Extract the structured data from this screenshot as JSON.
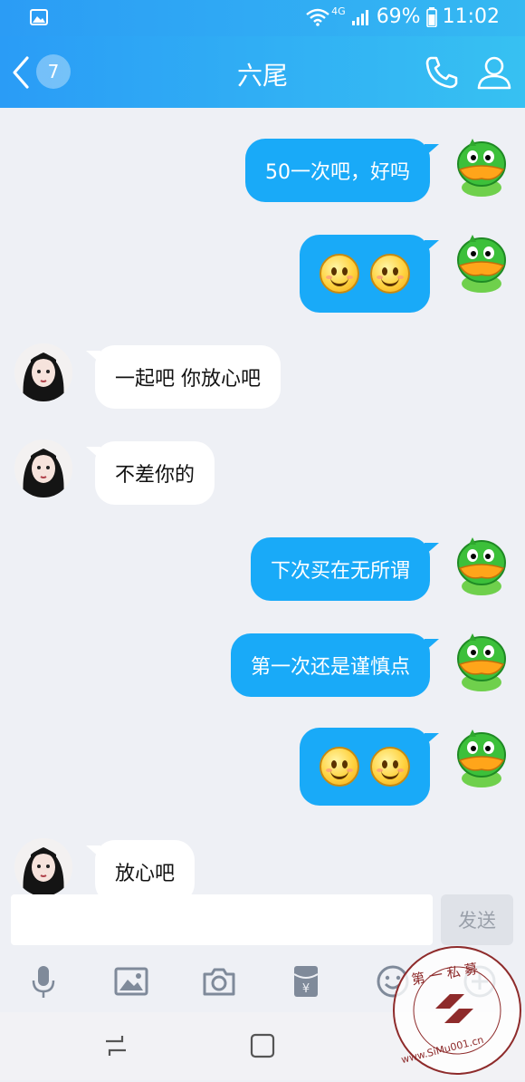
{
  "status_bar": {
    "network": "4G",
    "battery": "69%",
    "time": "11:02"
  },
  "header": {
    "back_badge": "7",
    "title": "六尾"
  },
  "messages": [
    {
      "side": "out",
      "text": "50一次吧，好吗"
    },
    {
      "side": "out",
      "emoji": [
        "smile",
        "smile"
      ]
    },
    {
      "side": "in",
      "text": "一起吧 你放心吧"
    },
    {
      "side": "in",
      "text": "不差你的"
    },
    {
      "side": "out",
      "text": "下次买在无所谓"
    },
    {
      "side": "out",
      "text": "第一次还是谨慎点"
    },
    {
      "side": "out",
      "emoji": [
        "smile",
        "smile"
      ]
    },
    {
      "side": "in",
      "text": "放心吧"
    }
  ],
  "composer": {
    "input_value": "",
    "input_placeholder": "",
    "send_label": "发送"
  },
  "toolbar": {
    "icons": [
      "microphone-icon",
      "image-icon",
      "camera-icon",
      "red-packet-icon",
      "emoji-icon",
      "plus-icon"
    ]
  },
  "watermark": {
    "text_top": "第 一 私 募",
    "text_bottom": "www.SiMu001.cn"
  },
  "colors": {
    "header_gradient_start": "#2a9cf6",
    "header_gradient_end": "#37c1f2",
    "outgoing_bubble": "#19aaf8",
    "incoming_bubble": "#ffffff",
    "chat_background": "#eef0f5"
  }
}
